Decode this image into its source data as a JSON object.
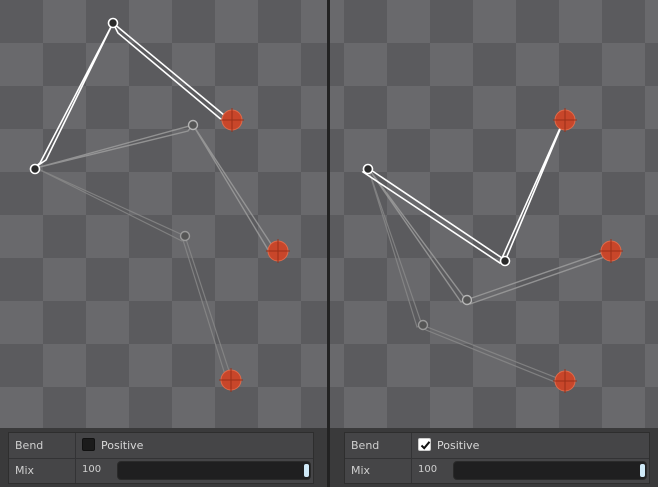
{
  "left_panel": {
    "bend_label": "Bend",
    "positive_label": "Positive",
    "positive_checked": false,
    "mix_label": "Mix",
    "mix_value": "100",
    "mix_fraction": 1.0
  },
  "right_panel": {
    "bend_label": "Bend",
    "positive_label": "Positive",
    "positive_checked": true,
    "mix_label": "Mix",
    "mix_value": "100",
    "mix_fraction": 1.0
  },
  "colors": {
    "checker_dark": "#5b5b5e",
    "checker_light": "#69696c",
    "target": "#c8462a",
    "bone_active": "#ffffff",
    "bone_inactive": "#a6a6a6",
    "slider_handle": "#cfe9f7"
  }
}
